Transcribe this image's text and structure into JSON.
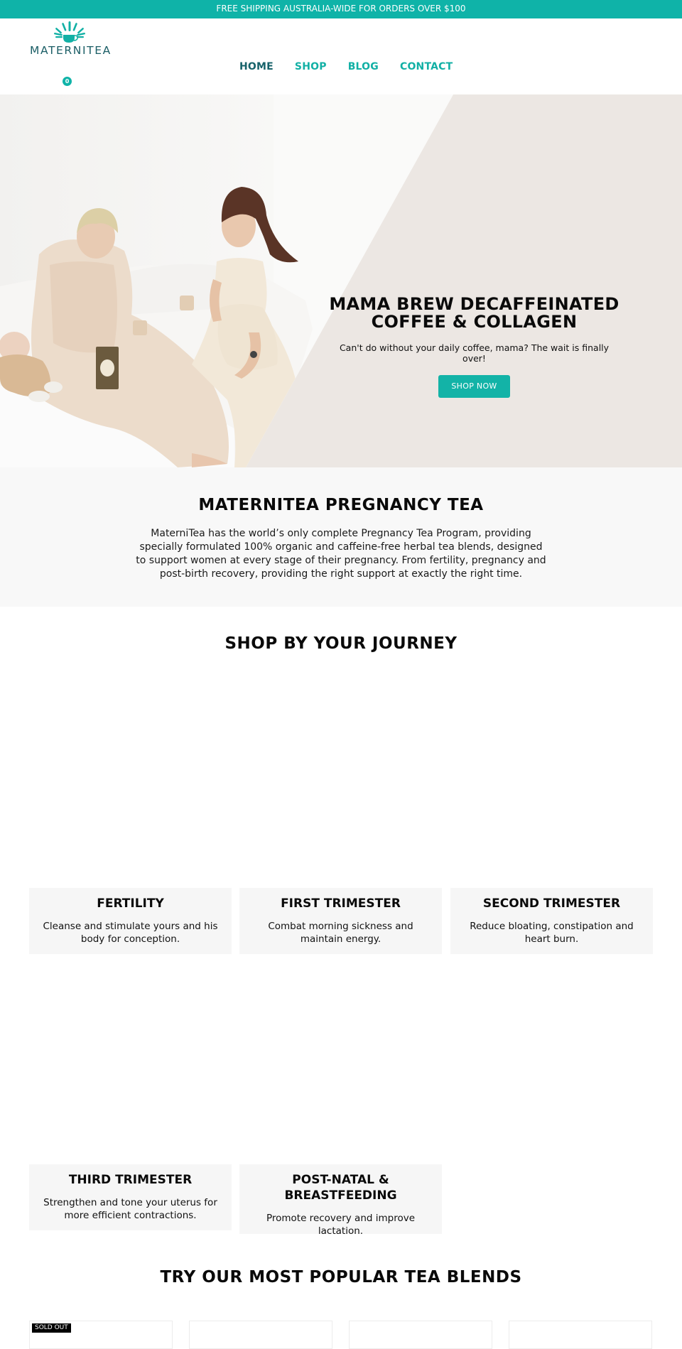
{
  "announcement": {
    "text": "FREE SHIPPING AUSTRALIA-WIDE FOR ORDERS OVER $100"
  },
  "header": {
    "logo_text": "MATERNITEA",
    "logo_icon": "teacup-sunburst-icon",
    "cart_count": "0",
    "nav": [
      {
        "label": "HOME",
        "active": true
      },
      {
        "label": "SHOP",
        "active": false
      },
      {
        "label": "BLOG",
        "active": false
      },
      {
        "label": "CONTACT",
        "active": false
      }
    ]
  },
  "hero": {
    "title_line1": "MAMA BREW DECAFFEINATED",
    "title_line2": "COFFEE & COLLAGEN",
    "subtitle": "Can't do without your daily coffee, mama? The wait is finally over!",
    "button_label": "SHOP NOW"
  },
  "about": {
    "title": "MATERNITEA PREGNANCY TEA",
    "body": "MaterniTea has the world’s only complete Pregnancy Tea Program, providing specially formulated 100% organic and caffeine-free herbal tea blends, designed to support women at every stage of their pregnancy. From fertility, pregnancy and post-birth recovery, providing the right support at exactly the right time."
  },
  "journey": {
    "title": "SHOP BY YOUR JOURNEY",
    "cards": [
      {
        "title": "FERTILITY",
        "description": "Cleanse and stimulate yours and his body for conception."
      },
      {
        "title": "FIRST TRIMESTER",
        "description": "Combat morning sickness and maintain energy."
      },
      {
        "title": "SECOND TRIMESTER",
        "description": "Reduce bloating, constipation and heart burn."
      },
      {
        "title": "THIRD TRIMESTER",
        "description": "Strengthen and tone your uterus for more efficient contractions."
      },
      {
        "title": "POST-NATAL & BREASTFEEDING",
        "description": "Promote recovery and improve lactation."
      }
    ]
  },
  "popular": {
    "title": "TRY OUR MOST POPULAR TEA BLENDS",
    "products": [
      {
        "badge": "SOLD OUT"
      },
      {
        "badge": null
      },
      {
        "badge": null
      },
      {
        "badge": null
      }
    ]
  },
  "colors": {
    "brand_teal": "#0fb3a8",
    "nav_active": "#17626a",
    "hero_bg": "#ece7e3",
    "section_gray": "#f8f8f8",
    "card_gray": "#f6f6f6"
  }
}
